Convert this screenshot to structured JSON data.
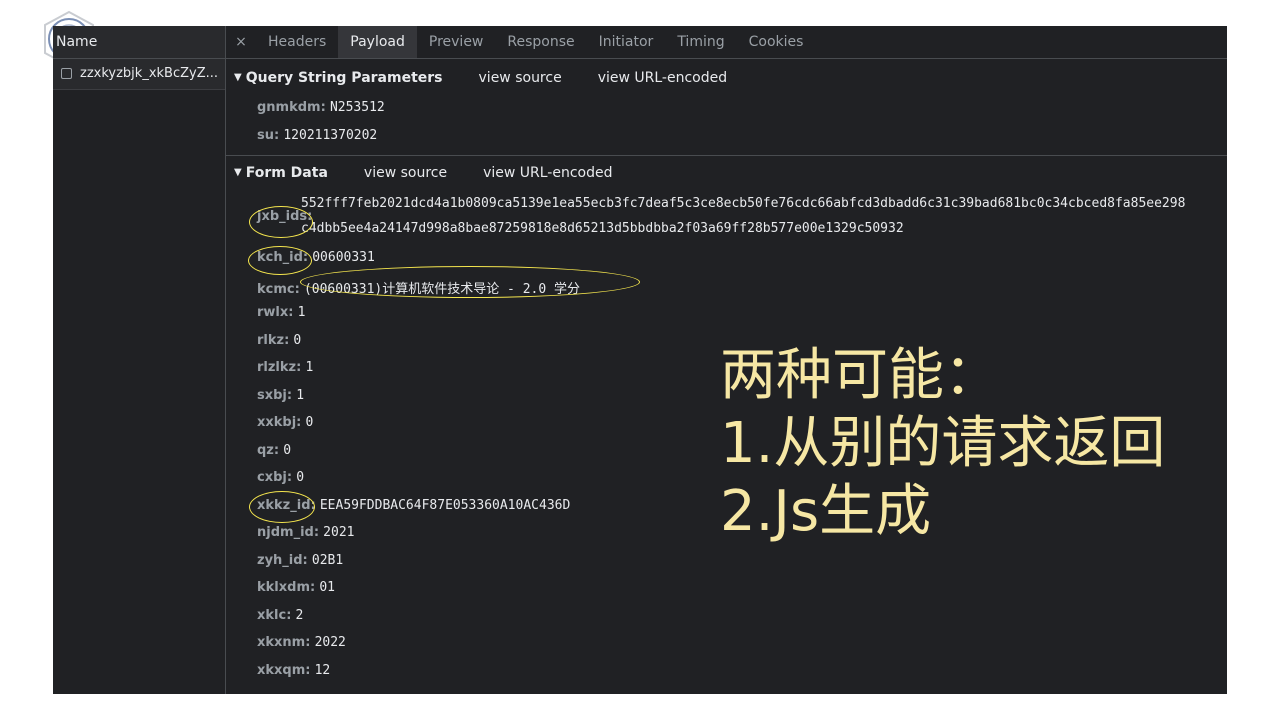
{
  "left_pane": {
    "header": "Name",
    "rows": [
      "zzxkyzbjk_xkBcZyZ..."
    ]
  },
  "tabs": {
    "close": "×",
    "items": [
      "Headers",
      "Payload",
      "Preview",
      "Response",
      "Initiator",
      "Timing",
      "Cookies"
    ],
    "active": "Payload"
  },
  "query": {
    "title": "Query String Parameters",
    "view_source": "view source",
    "view_url": "view URL-encoded",
    "params": [
      {
        "key": "gnmkdm:",
        "value": "N253512"
      },
      {
        "key": "su:",
        "value": "120211370202"
      }
    ]
  },
  "form": {
    "title": "Form Data",
    "view_source": "view source",
    "view_url": "view URL-encoded",
    "jxb_ids_key": "jxb_ids:",
    "jxb_ids_line1": "552fff7feb2021dcd4a1b0809ca5139e1ea55ecb3fc7deaf5c3ce8ecb50fe76cdc66abfcd3dbadd6c31c39bad681bc0c34cbced8fa85ee298",
    "jxb_ids_line2": "c4dbb5ee4a24147d998a8bae87259818e8d65213d5bbdbba2f03a69ff28b577e00e1329c50932",
    "params": [
      {
        "key": "kch_id:",
        "value": "00600331"
      },
      {
        "key": "kcmc:",
        "value": "(00600331)计算机软件技术导论 - 2.0 学分"
      },
      {
        "key": "rwlx:",
        "value": "1"
      },
      {
        "key": "rlkz:",
        "value": "0"
      },
      {
        "key": "rlzlkz:",
        "value": "1"
      },
      {
        "key": "sxbj:",
        "value": "1"
      },
      {
        "key": "xxkbj:",
        "value": "0"
      },
      {
        "key": "qz:",
        "value": "0"
      },
      {
        "key": "cxbj:",
        "value": "0"
      },
      {
        "key": "xkkz_id:",
        "value": "EEA59FDDBAC64F87E053360A10AC436D"
      },
      {
        "key": "njdm_id:",
        "value": "2021"
      },
      {
        "key": "zyh_id:",
        "value": "02B1"
      },
      {
        "key": "kklxdm:",
        "value": "01"
      },
      {
        "key": "xklc:",
        "value": "2"
      },
      {
        "key": "xkxnm:",
        "value": "2022"
      },
      {
        "key": "xkxqm:",
        "value": "12"
      }
    ]
  },
  "annotation": {
    "line1": "两种可能：",
    "line2": "1.从别的请求返回",
    "line3": "2.Js生成",
    "color": "#f6e7a4"
  },
  "highlight_color": "#f5e64e"
}
